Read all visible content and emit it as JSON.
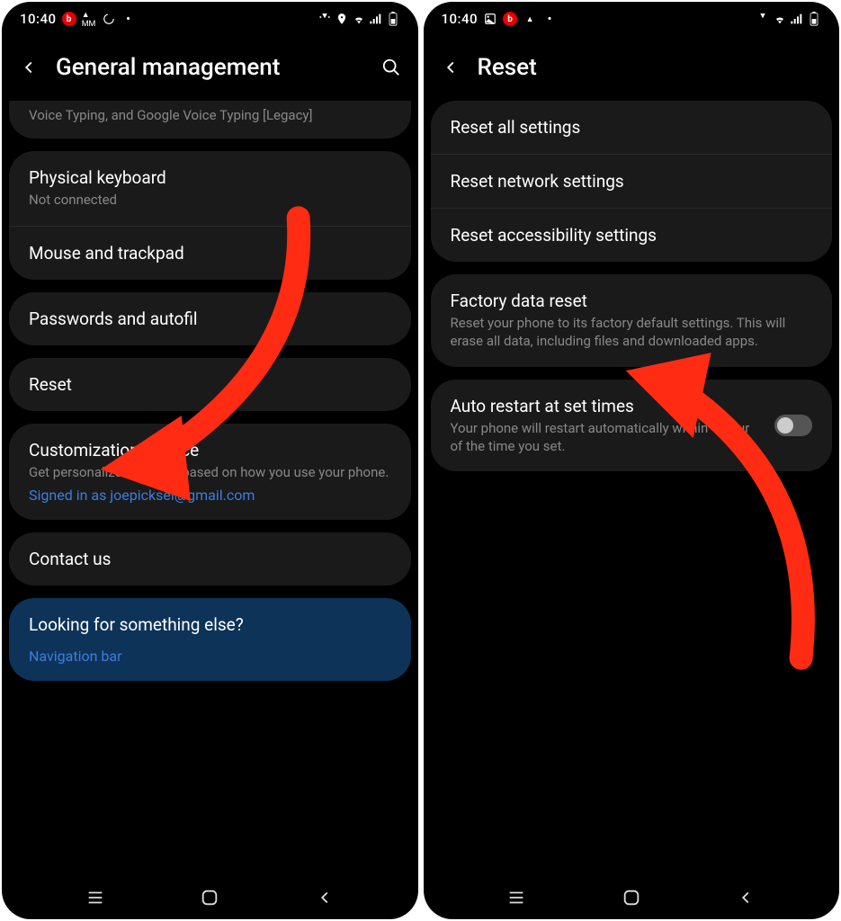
{
  "left": {
    "status": {
      "time": "10:40",
      "left_icons": [
        "beats",
        "mm-icon",
        "loading-icon",
        "dot-icon"
      ],
      "right_icons": [
        "vibrate-icon",
        "location-icon",
        "wifi-icon",
        "signal-icon",
        "battery-icon"
      ]
    },
    "header": {
      "title": "General management"
    },
    "cutoff_sub": "Voice Typing, and Google Voice Typing [Legacy]",
    "rows": {
      "physical_kb": {
        "title": "Physical keyboard",
        "sub": "Not connected"
      },
      "mouse": {
        "title": "Mouse and trackpad"
      },
      "passwords": {
        "title": "Passwords and autofil"
      },
      "reset": {
        "title": "Reset"
      },
      "customization": {
        "title": "Customization Service",
        "sub": "Get personalized content based on how you use your phone.",
        "link": "Signed in as joepicksel@gmail.com"
      },
      "contact": {
        "title": "Contact us"
      },
      "looking": {
        "title": "Looking for something else?",
        "link": "Navigation bar"
      }
    }
  },
  "right": {
    "status": {
      "time": "10:40",
      "left_icons": [
        "image-icon",
        "beats",
        "mm-icon",
        "dot-icon"
      ],
      "right_icons": [
        "vibrate-icon",
        "wifi-icon",
        "signal-icon",
        "battery-icon"
      ]
    },
    "header": {
      "title": "Reset"
    },
    "rows": {
      "reset_all": {
        "title": "Reset all settings"
      },
      "reset_network": {
        "title": "Reset network settings"
      },
      "reset_access": {
        "title": "Reset accessibility settings"
      },
      "factory": {
        "title": "Factory data reset",
        "sub": "Reset your phone to its factory default settings. This will erase all data, including files and downloaded apps."
      },
      "auto_restart": {
        "title": "Auto restart at set times",
        "sub": "Your phone will restart automatically within 1 hour of the time you set."
      }
    }
  },
  "colors": {
    "background": "#000000",
    "card": "#1a1a1a",
    "highlight": "#0d3358",
    "link": "#3b7de0",
    "arrow": "#ff2b12"
  }
}
